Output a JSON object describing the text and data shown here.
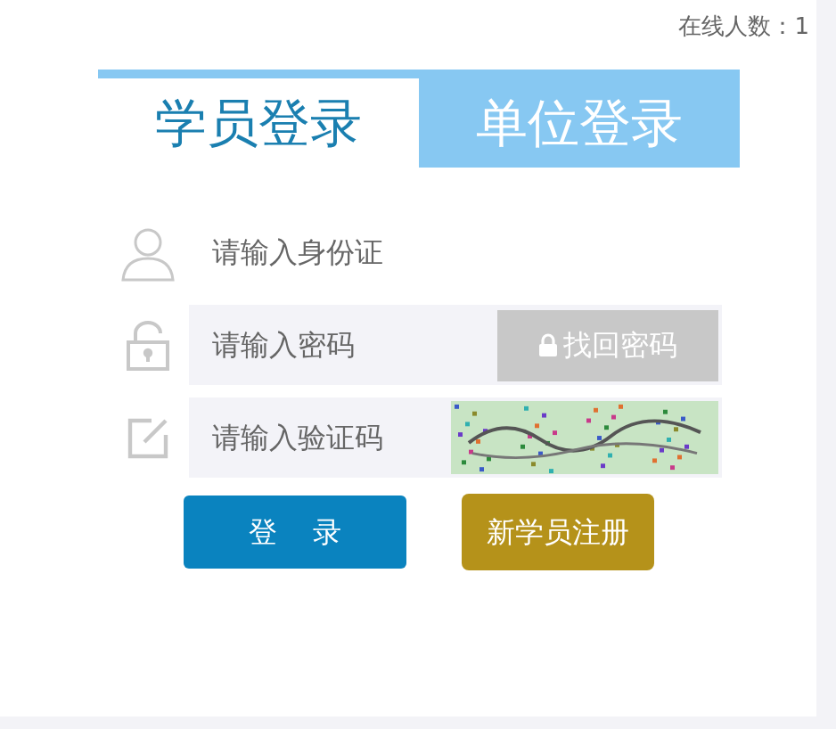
{
  "online_count": "在线人数：1",
  "tabs": [
    {
      "label": "学员登录",
      "selected": true
    },
    {
      "label": "单位登录",
      "selected": false
    }
  ],
  "fields": [
    {
      "kind": "id",
      "placeholder": "请输入身份证"
    },
    {
      "kind": "password",
      "placeholder": "请输入密码",
      "action": "找回密码"
    },
    {
      "kind": "captcha",
      "placeholder": "请输入验证码"
    }
  ],
  "buttons": [
    {
      "kind": "primary",
      "label": "登    录"
    },
    {
      "kind": "register",
      "label": "新学员注册"
    }
  ]
}
